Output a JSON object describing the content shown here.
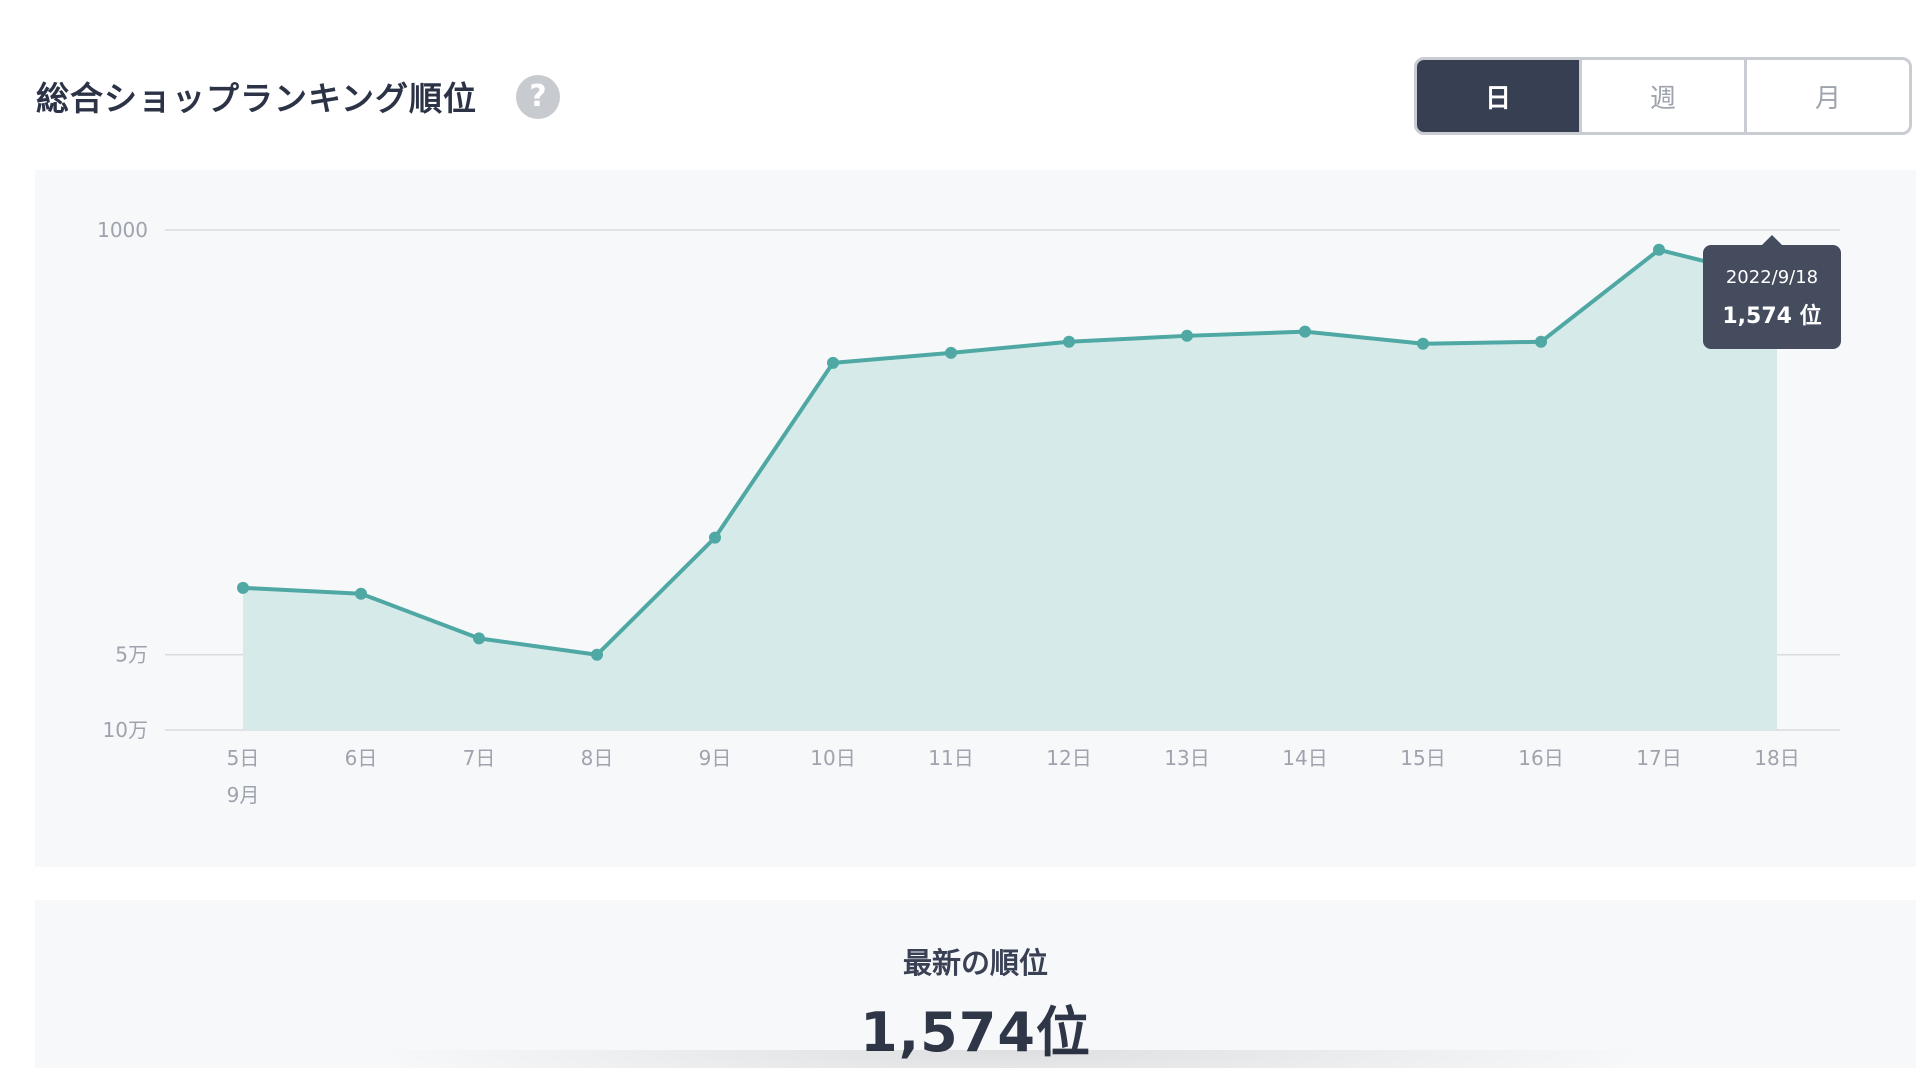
{
  "header": {
    "title": "総合ショップランキング順位",
    "help_icon": "?",
    "tabs": [
      {
        "label": "日",
        "active": true
      },
      {
        "label": "週",
        "active": false
      },
      {
        "label": "月",
        "active": false
      }
    ]
  },
  "chart_data": {
    "type": "area",
    "title": "",
    "xlabel": "",
    "ylabel": "",
    "y_scale": "log",
    "y_reversed": true,
    "ylim": [
      1000,
      100000
    ],
    "y_ticks": [
      {
        "value": 1000,
        "label": "1000"
      },
      {
        "value": 50000,
        "label": "5万"
      },
      {
        "value": 100000,
        "label": "10万"
      }
    ],
    "categories": [
      "5日",
      "6日",
      "7日",
      "8日",
      "9日",
      "10日",
      "11日",
      "12日",
      "13日",
      "14日",
      "15日",
      "16日",
      "17日",
      "18日"
    ],
    "month_label": "9月",
    "series": [
      {
        "values": [
          27000,
          28500,
          43000,
          50000,
          17000,
          3400,
          3100,
          2800,
          2650,
          2550,
          2850,
          2800,
          1200,
          1574
        ],
        "color": "#4fa8a3"
      }
    ],
    "grid": true,
    "tooltip": {
      "date": "2022/9/18",
      "value": "1,574 位"
    }
  },
  "latest": {
    "label": "最新の順位",
    "value": "1,574位"
  },
  "colors": {
    "line": "#4fa8a3",
    "area": "#d6ebe9",
    "active_tab": "#373f52",
    "grid": "#d9dbe0",
    "tick": "#9ea3ad"
  }
}
